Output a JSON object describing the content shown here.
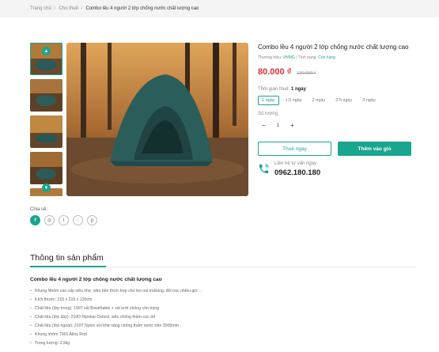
{
  "breadcrumb": {
    "home": "Trang chủ",
    "category": "Cho thuê",
    "current": "Combo lều 4 người 2 lớp chống nước chất lượng cao"
  },
  "gallery": {
    "up_icon": "chevron-up-icon",
    "down_icon": "chevron-down-icon"
  },
  "share": {
    "label": "Chia sẻ:",
    "icons": [
      "facebook-icon",
      "instagram-icon",
      "twitter-icon",
      "messenger-icon",
      "pinterest-icon"
    ]
  },
  "product": {
    "title": "Combo lều 4 người 2 lớp chống nước chất lượng cao",
    "brand_label": "Thương hiệu:",
    "brand": "VNMG",
    "status_label": "Tình trạng:",
    "status": "Còn hàng",
    "price": "80.000 ₫",
    "old_price": "120.000 ₫",
    "duration_label": "Thời gian thuê:",
    "duration_selected": "1 ngày",
    "durations": [
      "1 ngày",
      "1.5 ngày",
      "2 ngày",
      "2.5 ngày",
      "3 ngày"
    ],
    "quantity_label": "Số lượng:",
    "quantity": "1",
    "minus": "−",
    "plus": "+",
    "rent_button": "Thuê ngay",
    "cart_button": "Thêm vào giỏ",
    "contact_label": "Liên hệ tư vấn ngay",
    "phone": "0962.180.180"
  },
  "section": {
    "title": "Thông tin sản phẩm"
  },
  "description": {
    "title": "Combo lều 4 người 2 lớp chống nước chất lượng cao",
    "items": [
      "Khung Nhôm cao cấp siêu nhẹ, siêu bền thích hợp cho leo núi trekking, đổi trọc nhiều giờ ...",
      "Kích thước: 215 x 215 x 120cm",
      "Chất liệu (lớp trong): 190T vải Breathable + vải lưới chống côn trùng",
      "Chất liệu (lớp đáy): 210D Ripstop Oxford, siêu chống thấm cực tốt",
      "Chất liệu (lớp ngoài): 210T Nylon với khả năng chống thấm nước trên 3000mm",
      "Khung nhôm 7001 Alloy Rod",
      "Trọng lượng: 2,9kg"
    ]
  },
  "colors": {
    "accent": "#1aa58f",
    "price": "#e03131"
  }
}
